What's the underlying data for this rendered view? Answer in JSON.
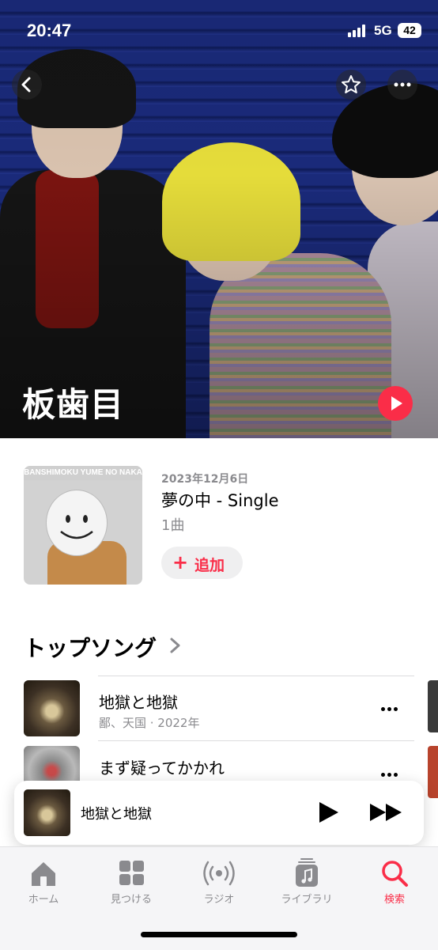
{
  "status_bar": {
    "time": "20:47",
    "network": "5G",
    "battery": "42"
  },
  "artist": {
    "name": "板歯目"
  },
  "latest_release": {
    "art_text": "BANSHIMOKU YUME NO NAKA",
    "date": "2023年12月6日",
    "title": "夢の中 - Single",
    "track_count": "1曲",
    "add_label": "追加"
  },
  "top_songs": {
    "heading": "トップソング",
    "items": [
      {
        "title": "地獄と地獄",
        "subtitle": "鄙、天国 · 2022年"
      },
      {
        "title": "まず疑ってかかれ",
        "subtitle": ""
      }
    ]
  },
  "now_playing": {
    "title": "地獄と地獄"
  },
  "tabs": [
    {
      "label": "ホーム",
      "icon": "house-icon",
      "active": false
    },
    {
      "label": "見つける",
      "icon": "grid-icon",
      "active": false
    },
    {
      "label": "ラジオ",
      "icon": "radio-icon",
      "active": false
    },
    {
      "label": "ライブラリ",
      "icon": "library-icon",
      "active": false
    },
    {
      "label": "検索",
      "icon": "search-icon",
      "active": true
    }
  ],
  "colors": {
    "accent": "#fa2d48",
    "secondary_text": "#8a8a8e",
    "tab_icon": "#8a8a8e"
  }
}
